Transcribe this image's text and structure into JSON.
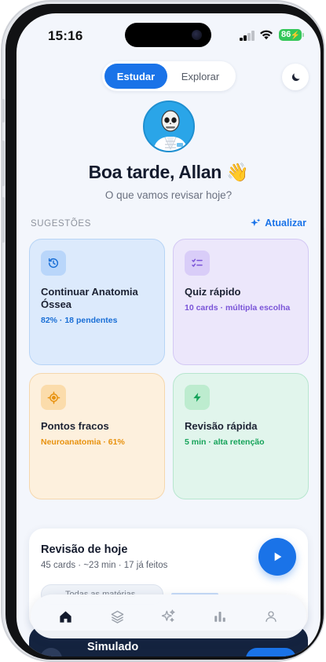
{
  "status_bar": {
    "time": "15:16",
    "battery": "86"
  },
  "mode_switch": {
    "options": [
      "Estudar",
      "Explorar"
    ],
    "selected": "Estudar"
  },
  "theme_toggle": {
    "icon": "moon-icon"
  },
  "profile": {
    "greeting": "Boa tarde, Allan 👋",
    "prompt": "O que vamos revisar hoje?"
  },
  "suggestions": {
    "section_label": "SUGESTÕES",
    "refresh_label": "Atualizar",
    "cards": [
      {
        "title": "Continuar Anatomia Óssea",
        "meta": "82% · 18 pendentes",
        "icon": "history-icon",
        "accent": "#1a6fd6"
      },
      {
        "title": "Quiz rápido",
        "meta": "10 cards · múltipla escolha",
        "icon": "checklist-icon",
        "accent": "#7a54d8"
      },
      {
        "title": "Pontos fracos",
        "meta": "Neuroanatomia · 61%",
        "icon": "target-icon",
        "accent": "#e8920f"
      },
      {
        "title": "Revisão rápida",
        "meta": "5 min · alta retenção",
        "icon": "lightning-icon",
        "accent": "#16a35a"
      }
    ]
  },
  "review": {
    "title": "Revisão de hoje",
    "summary": "45 cards · ~23 min · 17 já feitos",
    "chip": "Todas as matérias"
  },
  "promo": {
    "title": "Simulado"
  },
  "tabbar": {
    "tabs": [
      {
        "icon": "home-icon",
        "active": true
      },
      {
        "icon": "layers-icon",
        "active": false
      },
      {
        "icon": "sparkles-icon",
        "active": false
      },
      {
        "icon": "bar-chart-icon",
        "active": false
      },
      {
        "icon": "person-icon",
        "active": false
      }
    ]
  },
  "colors": {
    "accent": "#1a73e8",
    "background": "#f3f6fc"
  }
}
